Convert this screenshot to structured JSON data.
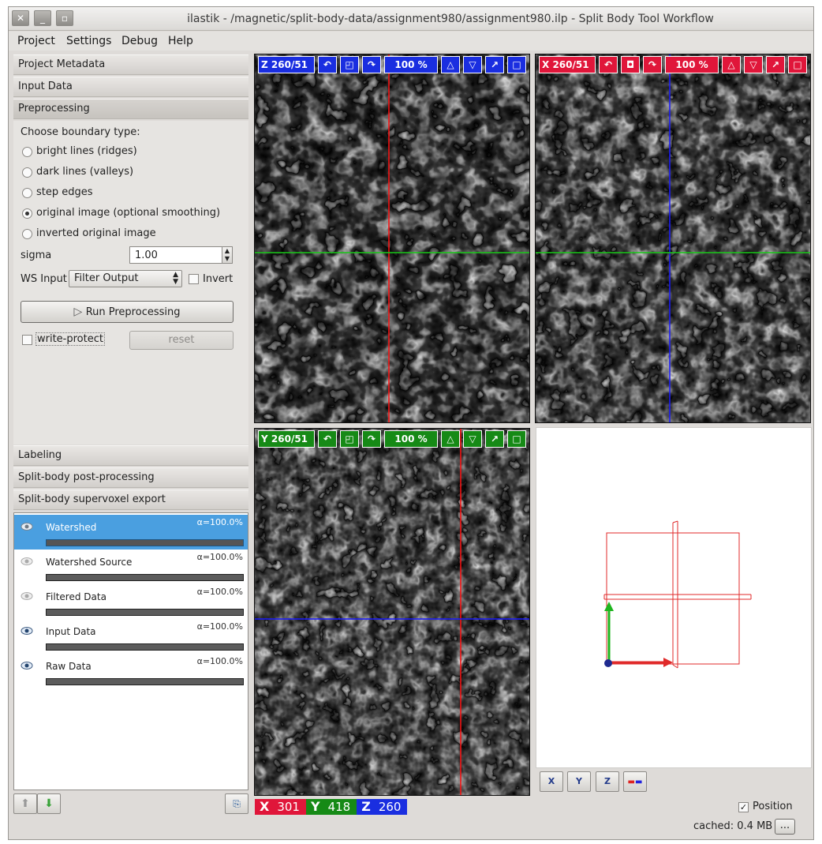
{
  "window": {
    "title": "ilastik - /magnetic/split-body-data/assignment980/assignment980.ilp - Split Body Tool Workflow",
    "close_label": "✕",
    "minimize_label": "_",
    "maximize_label": "▫"
  },
  "menu": [
    "Project",
    "Settings",
    "Debug",
    "Help"
  ],
  "applets": {
    "top": [
      "Project Metadata",
      "Input Data",
      "Preprocessing"
    ],
    "bottom": [
      "Labeling",
      "Split-body post-processing",
      "Split-body supervoxel export"
    ]
  },
  "preprocessing": {
    "boundary_label": "Choose boundary type:",
    "options": [
      "bright lines (ridges)",
      "dark lines (valleys)",
      "step edges",
      "original image (optional smoothing)",
      "inverted original image"
    ],
    "selected_index": 3,
    "sigma_label": "sigma",
    "sigma_value": "1.00",
    "ws_input_label": "WS Input",
    "ws_input_value": "Filter Output",
    "invert_label": "Invert",
    "run_label": "Run Preprocessing",
    "write_protect_label": "write-protect",
    "reset_label": "reset"
  },
  "layers": [
    {
      "name": "Watershed",
      "alpha": "α=100.0%",
      "visible": true,
      "selected": true
    },
    {
      "name": "Watershed Source",
      "alpha": "α=100.0%",
      "visible": false,
      "selected": false
    },
    {
      "name": "Filtered Data",
      "alpha": "α=100.0%",
      "visible": false,
      "selected": false
    },
    {
      "name": "Input Data",
      "alpha": "α=100.0%",
      "visible": true,
      "selected": false
    },
    {
      "name": "Raw Data",
      "alpha": "α=100.0%",
      "visible": true,
      "selected": false
    }
  ],
  "viewers": {
    "z": {
      "axis": "Z",
      "slice": "260/51",
      "zoom": "100 %",
      "color": "#1a2ee0"
    },
    "x": {
      "axis": "X",
      "slice": "260/51",
      "zoom": "100 %",
      "color": "#e0163a"
    },
    "y": {
      "axis": "Y",
      "slice": "260/51",
      "zoom": "100 %",
      "color": "#168a16"
    }
  },
  "position": {
    "x_label": "X",
    "x": "301",
    "y_label": "Y",
    "y": "418",
    "z_label": "Z",
    "z": "260"
  },
  "view3d_buttons": [
    "X",
    "Y",
    "Z"
  ],
  "status": {
    "position_label": "Position",
    "position_checked": true,
    "cached_label": "cached: 0.4 MB",
    "more_label": "..."
  },
  "colors": {
    "selected": "#4a9fe0",
    "x_axis": "#e0163a",
    "y_axis": "#168a16",
    "z_axis": "#1a2ee0"
  }
}
